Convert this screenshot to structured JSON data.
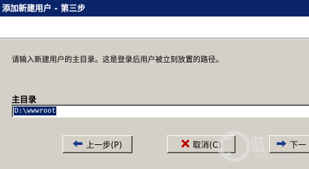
{
  "window": {
    "title": "添加新建用户 - 第三步"
  },
  "main": {
    "description": "请输入新建用户的主目录。这是登录后用户被立刻放置的路径。",
    "dir_label": "主目录",
    "dir_value": "D:\\wwwroot"
  },
  "buttons": {
    "back_label": "上一步(P)",
    "cancel_label": "取消(C)",
    "next_label": "下一"
  },
  "watermark": {
    "text": "蓝",
    "sub": "lanbui.com"
  },
  "icons": {
    "back": "left-arrow-icon",
    "cancel": "x-icon",
    "next": "right-arrow-icon"
  },
  "colors": {
    "titlebar": "#0a246a",
    "dialog_bg": "#d4d0c8",
    "selection": "#0a246a",
    "cancel_icon": "#c00000",
    "arrow_icon": "#1a3c8c"
  }
}
